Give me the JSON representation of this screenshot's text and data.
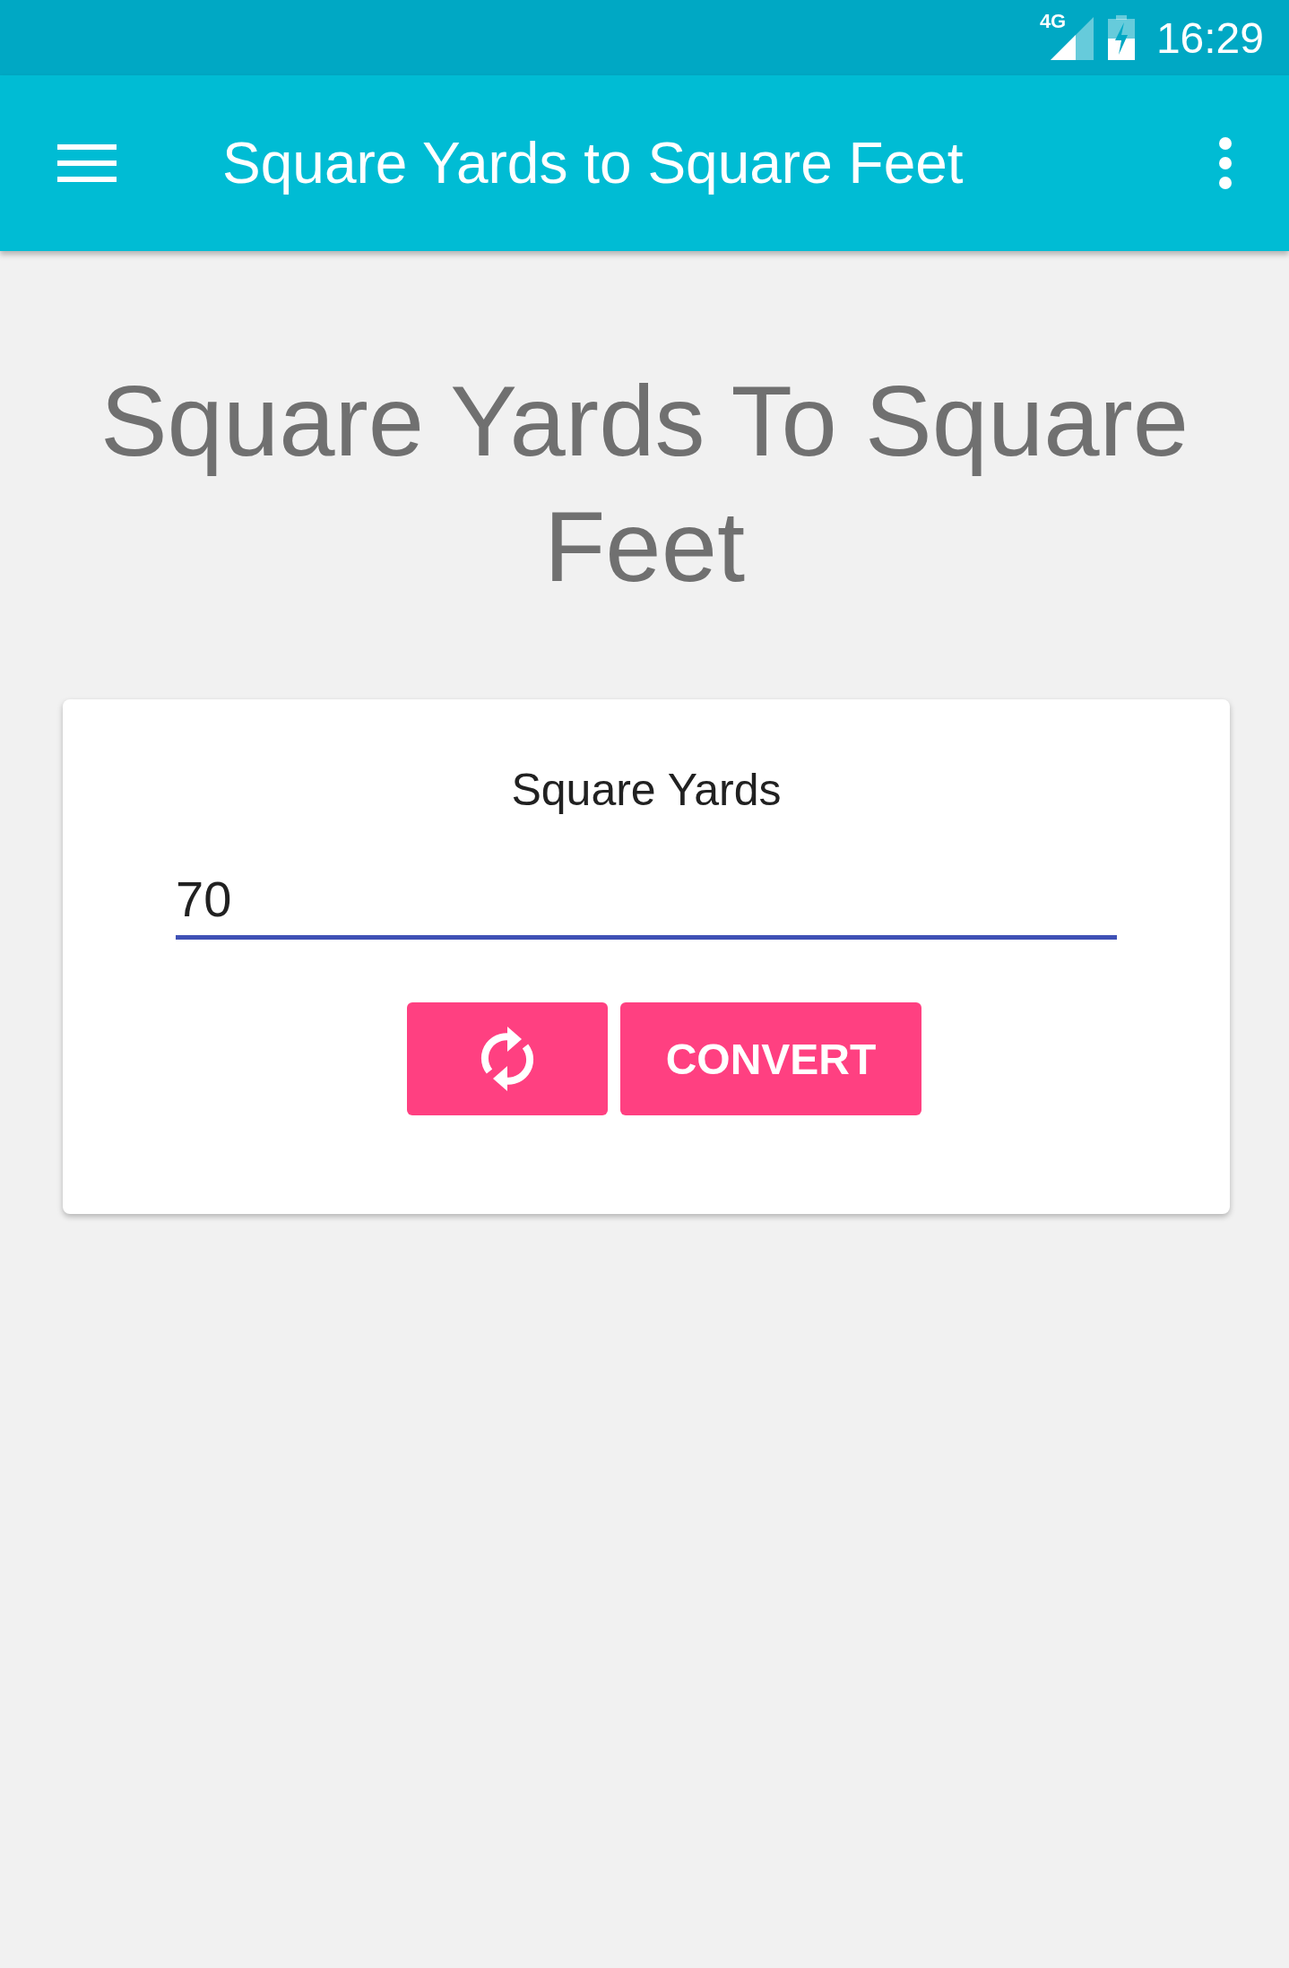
{
  "status_bar": {
    "network": "4G",
    "time": "16:29"
  },
  "app_bar": {
    "title": "Square Yards to Square Feet"
  },
  "heading": "Square Yards To Square Feet",
  "card": {
    "label": "Square Yards",
    "input": {
      "value": "70",
      "focused": true
    },
    "buttons": [
      {
        "kind": "reset"
      },
      {
        "kind": "text",
        "label": "CONVERT"
      }
    ]
  }
}
